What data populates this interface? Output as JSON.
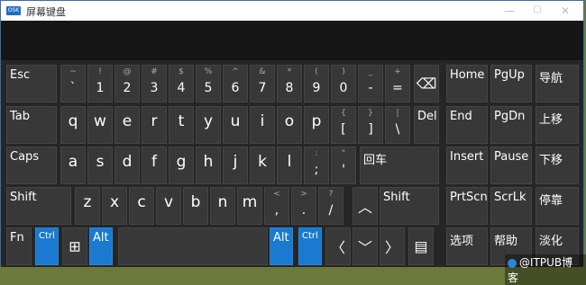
{
  "window": {
    "title": "屏幕键盘",
    "icon": "osk-app-icon"
  },
  "controls": {
    "minimize": "—",
    "maximize": "☐",
    "close": "✕"
  },
  "rows": {
    "r1": [
      {
        "id": "esc",
        "label": "Esc"
      },
      {
        "id": "backtick",
        "sub": "~",
        "main": "`"
      },
      {
        "id": "1",
        "sub": "!",
        "main": "1"
      },
      {
        "id": "2",
        "sub": "@",
        "main": "2"
      },
      {
        "id": "3",
        "sub": "#",
        "main": "3"
      },
      {
        "id": "4",
        "sub": "$",
        "main": "4"
      },
      {
        "id": "5",
        "sub": "%",
        "main": "5"
      },
      {
        "id": "6",
        "sub": "^",
        "main": "6"
      },
      {
        "id": "7",
        "sub": "&",
        "main": "7"
      },
      {
        "id": "8",
        "sub": "*",
        "main": "8"
      },
      {
        "id": "9",
        "sub": "(",
        "main": "9"
      },
      {
        "id": "0",
        "sub": ")",
        "main": "0"
      },
      {
        "id": "minus",
        "sub": "_",
        "main": "-"
      },
      {
        "id": "equals",
        "sub": "+",
        "main": "="
      },
      {
        "id": "backspace",
        "icon": "⌫"
      }
    ],
    "r2": [
      {
        "id": "tab",
        "label": "Tab"
      },
      {
        "id": "q",
        "main": "q"
      },
      {
        "id": "w",
        "main": "w"
      },
      {
        "id": "e",
        "main": "e"
      },
      {
        "id": "r",
        "main": "r"
      },
      {
        "id": "t",
        "main": "t"
      },
      {
        "id": "y",
        "main": "y"
      },
      {
        "id": "u",
        "main": "u"
      },
      {
        "id": "i",
        "main": "i"
      },
      {
        "id": "o",
        "main": "o"
      },
      {
        "id": "p",
        "main": "p"
      },
      {
        "id": "lbracket",
        "sub": "{",
        "main": "["
      },
      {
        "id": "rbracket",
        "sub": "}",
        "main": "]"
      },
      {
        "id": "backslash",
        "sub": "|",
        "main": "\\"
      },
      {
        "id": "del",
        "label": "Del"
      }
    ],
    "r3": [
      {
        "id": "caps",
        "label": "Caps"
      },
      {
        "id": "a",
        "main": "a"
      },
      {
        "id": "s",
        "main": "s"
      },
      {
        "id": "d",
        "main": "d"
      },
      {
        "id": "f",
        "main": "f"
      },
      {
        "id": "g",
        "main": "g"
      },
      {
        "id": "h",
        "main": "h"
      },
      {
        "id": "j",
        "main": "j"
      },
      {
        "id": "k",
        "main": "k"
      },
      {
        "id": "l",
        "main": "l"
      },
      {
        "id": "semicolon",
        "sub": ":",
        "main": ";"
      },
      {
        "id": "quote",
        "sub": "\"",
        "main": "'"
      },
      {
        "id": "enter",
        "label": "回车"
      }
    ],
    "r4": [
      {
        "id": "lshift",
        "label": "Shift"
      },
      {
        "id": "z",
        "main": "z"
      },
      {
        "id": "x",
        "main": "x"
      },
      {
        "id": "c",
        "main": "c"
      },
      {
        "id": "v",
        "main": "v"
      },
      {
        "id": "b",
        "main": "b"
      },
      {
        "id": "n",
        "main": "n"
      },
      {
        "id": "m",
        "main": "m"
      },
      {
        "id": "comma",
        "sub": "<",
        "main": ","
      },
      {
        "id": "period",
        "sub": ">",
        "main": "."
      },
      {
        "id": "slash",
        "sub": "?",
        "main": "/"
      },
      {
        "id": "up",
        "icon": "︿"
      },
      {
        "id": "rshift",
        "label": "Shift"
      }
    ],
    "r5": [
      {
        "id": "fn",
        "label": "Fn"
      },
      {
        "id": "lctrl",
        "label": "Ctrl"
      },
      {
        "id": "win",
        "icon": "⊞"
      },
      {
        "id": "lalt",
        "label": "Alt"
      },
      {
        "id": "space",
        "label": ""
      },
      {
        "id": "ralt",
        "label": "Alt"
      },
      {
        "id": "rctrl",
        "label": "Ctrl"
      },
      {
        "id": "left",
        "icon": "〈"
      },
      {
        "id": "down",
        "icon": "﹀"
      },
      {
        "id": "right",
        "icon": "〉"
      },
      {
        "id": "menu",
        "icon": "▤"
      }
    ],
    "nav": [
      {
        "id": "home",
        "label": "Home"
      },
      {
        "id": "pgup",
        "label": "PgUp"
      },
      {
        "id": "nav",
        "label": "导航"
      },
      {
        "id": "end",
        "label": "End"
      },
      {
        "id": "pgdn",
        "label": "PgDn"
      },
      {
        "id": "moveup",
        "label": "上移"
      },
      {
        "id": "insert",
        "label": "Insert"
      },
      {
        "id": "pause",
        "label": "Pause"
      },
      {
        "id": "movedown",
        "label": "下移"
      },
      {
        "id": "prtscn",
        "label": "PrtScn"
      },
      {
        "id": "scrlk",
        "label": "ScrLk"
      },
      {
        "id": "dock",
        "label": "停靠"
      },
      {
        "id": "options",
        "label": "选项"
      },
      {
        "id": "help",
        "label": "帮助"
      },
      {
        "id": "fade",
        "label": "淡化"
      }
    ]
  },
  "watermark": "@ITPUB博客",
  "colors": {
    "key": "#383838",
    "active": "#1a7ad1",
    "background": "#262626",
    "titlebar": "#ffffff"
  }
}
